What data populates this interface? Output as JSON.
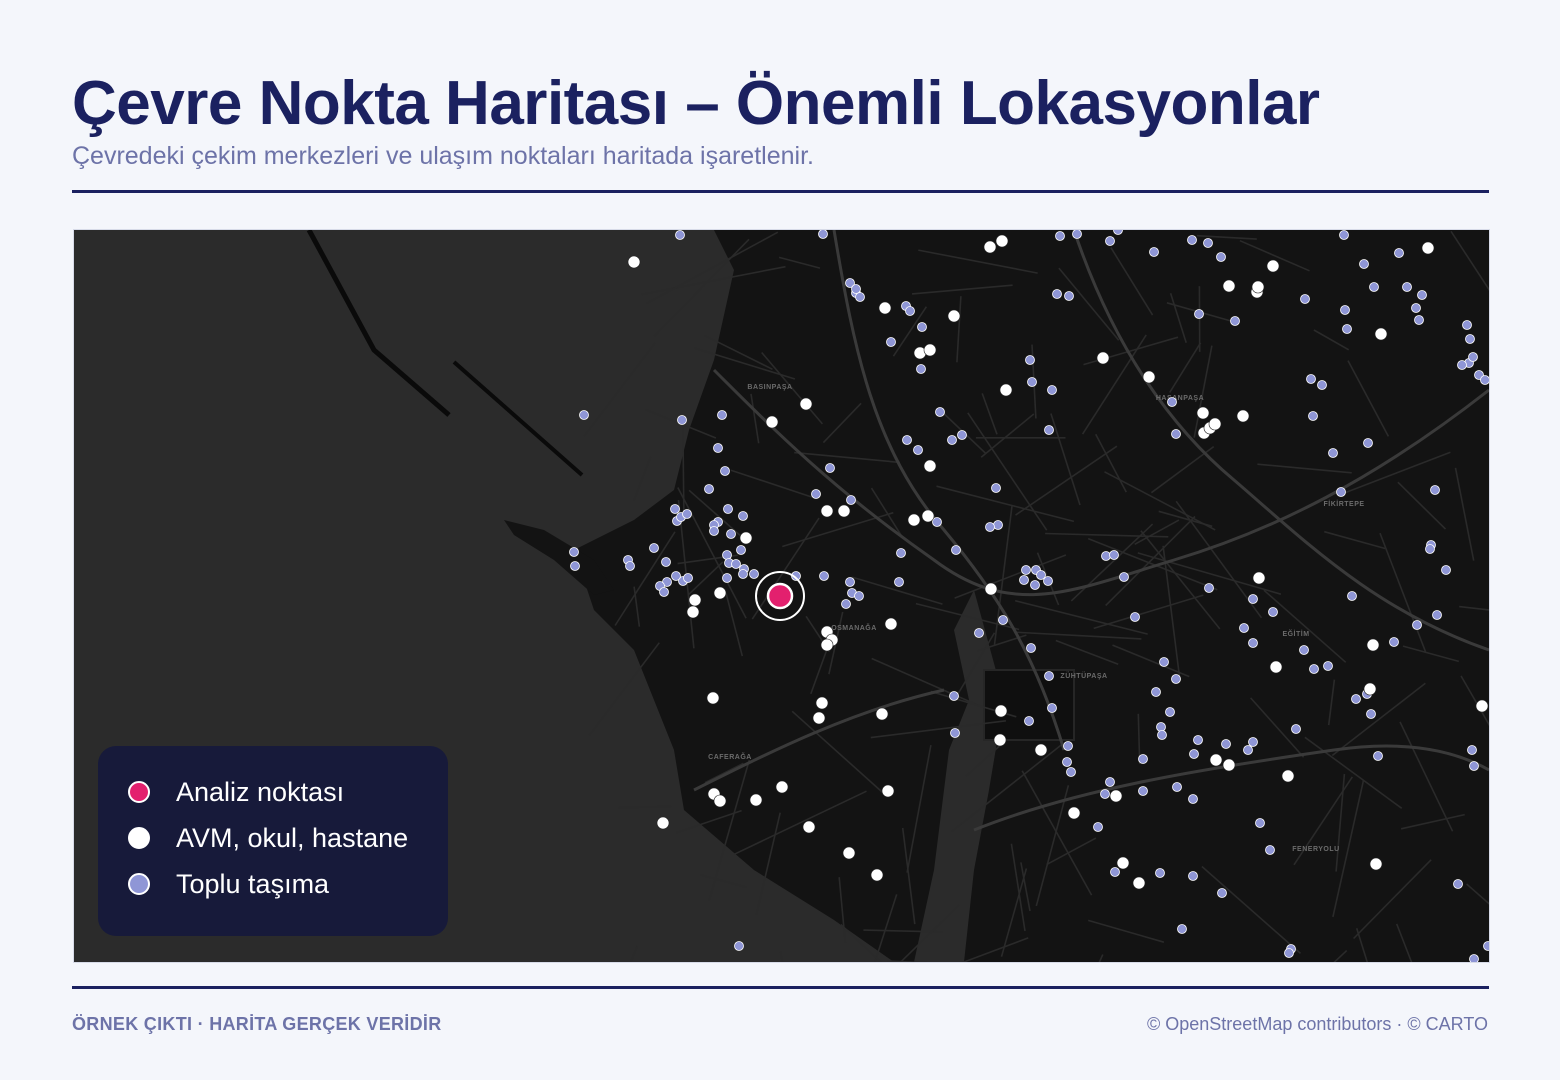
{
  "title": "Çevre Nokta Haritası – Önemli Lokasyonlar",
  "subtitle": "Çevredeki çekim merkezleri ve ulaşım noktaları haritada işaretlenir.",
  "colors": {
    "analysis_point": "#e3206e",
    "poi": "#ffffff",
    "transit": "#8f96d6",
    "map_land": "#131313",
    "map_water": "#2b2b2b",
    "title": "#1b2160",
    "legend_bg": "#171a3a"
  },
  "legend": [
    {
      "key": "analysis",
      "label": "Analiz noktası",
      "color": "#e3206e"
    },
    {
      "key": "poi",
      "label": "AVM, okul, hastane",
      "color": "#ffffff"
    },
    {
      "key": "transit",
      "label": "Toplu taşıma",
      "color": "#8f96d6"
    }
  ],
  "map_labels": [
    "BASINPAŞA",
    "HASANPAŞA",
    "OSMANAĞA",
    "ZÜHTÜPAŞA",
    "CAFERAĞA",
    "FENERYOLU",
    "FİKİRTEPE",
    "EĞİTİM"
  ],
  "footer": {
    "left": "ÖRNEK ÇIKTI · HARİTA GERÇEK VERİDİR",
    "right": "© OpenStreetMap contributors · © CARTO"
  }
}
